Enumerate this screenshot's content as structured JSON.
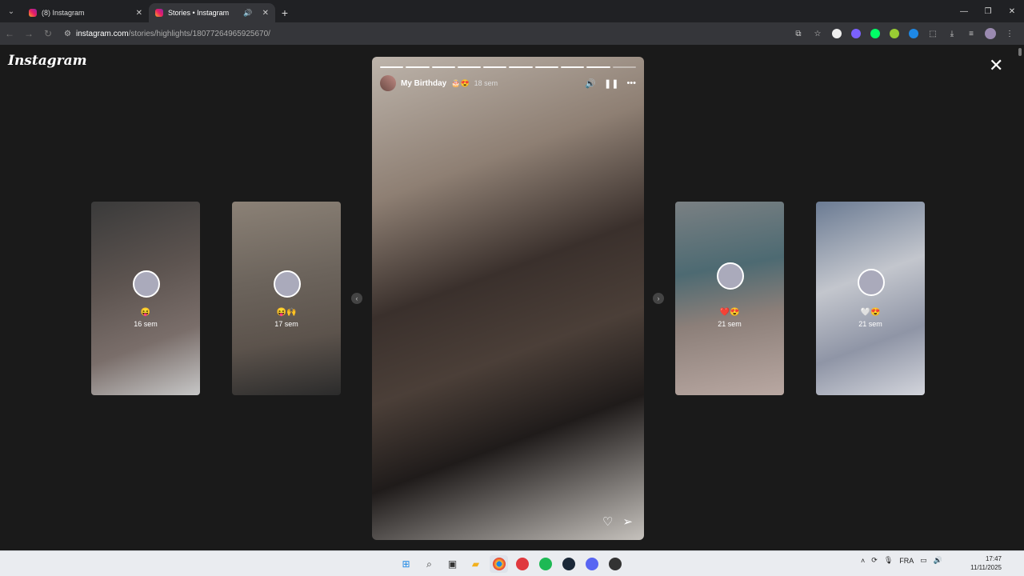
{
  "browser": {
    "tabs": [
      {
        "title": "(8) Instagram",
        "active": false
      },
      {
        "title": "Stories • Instagram",
        "active": true
      }
    ],
    "url_host": "instagram.com",
    "url_path": "/stories/highlights/18077264965925670/"
  },
  "page": {
    "logo": "Instagram",
    "close_glyph": "✕"
  },
  "story": {
    "title": "My Birthday",
    "emoji": "🎂😍",
    "age": "18 sem",
    "progress_segments_total": 10,
    "progress_segments_done": 9
  },
  "previews": {
    "left": [
      {
        "emoji": "😝",
        "age": "16 sem"
      },
      {
        "emoji": "😝🙌",
        "age": "17 sem"
      }
    ],
    "right": [
      {
        "emoji": "❤️😍",
        "age": "21 sem"
      },
      {
        "emoji": "🤍😍",
        "age": "21 sem"
      }
    ]
  },
  "taskbar": {
    "language": "FRA",
    "time": "17:47",
    "date": "11/11/2025"
  },
  "colors": {
    "background": "#1a1a1a",
    "taskbar": "#eaecf0",
    "browser_chrome": "#202124"
  }
}
